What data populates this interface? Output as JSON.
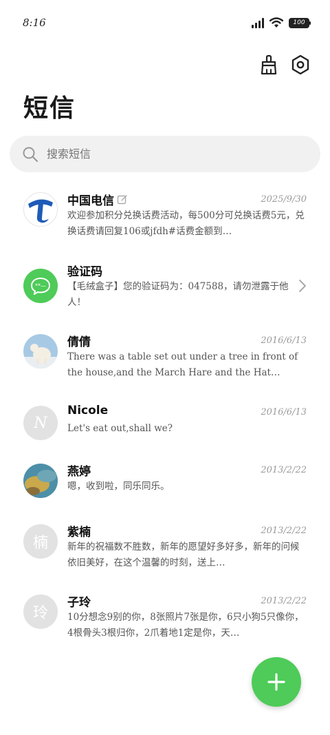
{
  "status_bar": {
    "time": "8:16",
    "battery": "100"
  },
  "header": {
    "title": "短信"
  },
  "search": {
    "placeholder": "搜索短信"
  },
  "conversations": [
    {
      "name": "中国电信",
      "date": "2025/9/30",
      "snippet": "欢迎参加积分兑换话费活动，每500分可兑换话费5元，兑换话费请回复106或jfdh#话费金额到…",
      "avatar": "china-telecom-logo"
    },
    {
      "name": "验证码",
      "date": "",
      "snippet": "【毛绒盒子】您的验证码为：047588，请勿泄露于他人！",
      "avatar": "verification-code-icon"
    },
    {
      "name": "倩倩",
      "date": "2016/6/13",
      "snippet": "There was a table set out under a tree in front of the house,and the March Hare and the Hat…",
      "avatar": "polar-bear-photo"
    },
    {
      "name": "Nicole",
      "date": "2016/6/13",
      "snippet": "Let's eat out,shall we?",
      "avatar_letter": "N"
    },
    {
      "name": "燕婷",
      "date": "2013/2/22",
      "snippet": "嗯，收到啦，同乐同乐。",
      "avatar": "landscape-photo"
    },
    {
      "name": "紫楠",
      "date": "2013/2/22",
      "snippet": "新年的祝福数不胜数，新年的愿望好多好多，新年的问候依旧美好，在这个温馨的时刻，送上…",
      "avatar_letter": "楠"
    },
    {
      "name": "子玲",
      "date": "2013/2/22",
      "snippet": "10分想念9别的你，8张照片7张是你，6只小狗5只像你，4根骨头3根归你，2爪着地1定是你，天…",
      "avatar_letter": "玲"
    }
  ],
  "colors": {
    "accent": "#4ecb58",
    "search_bg": "#f1f1f1",
    "telecom_blue": "#1e5bb8"
  }
}
